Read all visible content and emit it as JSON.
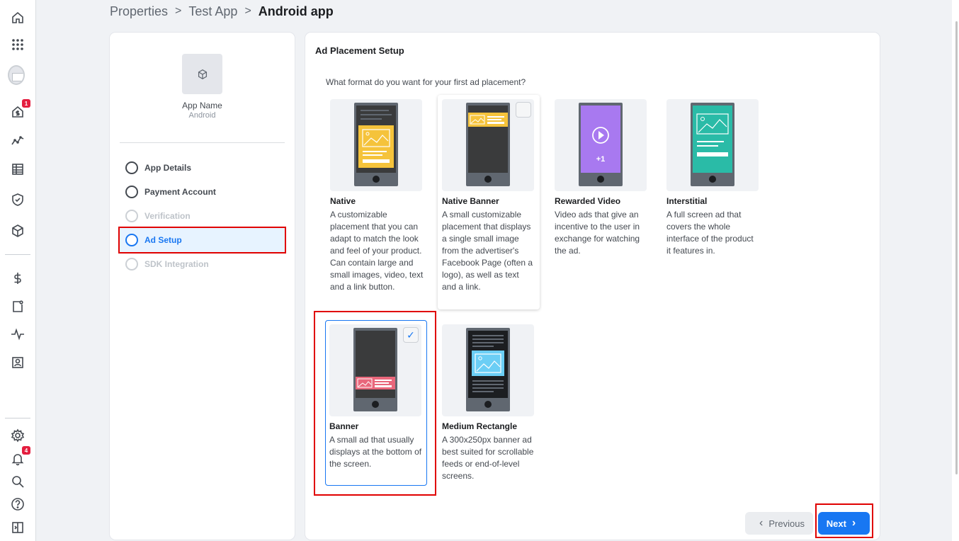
{
  "breadcrumb": {
    "item1": "Properties",
    "item2": "Test App",
    "item3": "Android app",
    "sep": ">"
  },
  "app": {
    "name": "App Name",
    "platform": "Android"
  },
  "steps": [
    {
      "label": "App Details",
      "state": "done"
    },
    {
      "label": "Payment Account",
      "state": "done"
    },
    {
      "label": "Verification",
      "state": "disabled"
    },
    {
      "label": "Ad Setup",
      "state": "active"
    },
    {
      "label": "SDK Integration",
      "state": "disabled"
    }
  ],
  "rail": {
    "badge_payments": "1",
    "badge_notifications": "4",
    "icons": [
      "home-icon",
      "apps-grid-icon",
      "avatar-icon",
      "monetization-icon",
      "analytics-icon",
      "reports-icon",
      "integrity-icon",
      "properties-icon",
      "payouts-icon",
      "ad-units-icon",
      "activity-icon",
      "business-icon",
      "settings-icon",
      "notifications-icon",
      "search-icon",
      "help-icon",
      "collapse-icon"
    ]
  },
  "main": {
    "title": "Ad Placement Setup",
    "question": "What format do you want for your first ad placement?",
    "formats": [
      {
        "name": "Native",
        "desc": "A customizable placement that you can adapt to match the look and feel of your product. Can contain large and small images, video, text and a link button."
      },
      {
        "name": "Native Banner",
        "desc": "A small customizable placement that displays a single small image from the advertiser's Facebook Page (often a logo), as well as text and a link."
      },
      {
        "name": "Rewarded Video",
        "desc": "Video ads that give an incentive to the user in exchange for watching the ad.",
        "badge": "+1"
      },
      {
        "name": "Interstitial",
        "desc": "A full screen ad that covers the whole interface of the product it features in."
      },
      {
        "name": "Banner",
        "desc": "A small ad that usually displays at the bottom of the screen.",
        "check": "✓"
      },
      {
        "name": "Medium Rectangle",
        "desc": "A 300x250px banner ad best suited for scrollable feeds or end-of-level screens."
      }
    ],
    "prev_label": "Previous",
    "next_label": "Next"
  },
  "colors": {
    "accent": "#1877f2",
    "highlight": "#e00000",
    "native": "#f5c33b",
    "rewarded": "#a879f0",
    "interstitial": "#2abba7",
    "banner": "#e9677b",
    "medium_rect": "#6bcef5"
  }
}
